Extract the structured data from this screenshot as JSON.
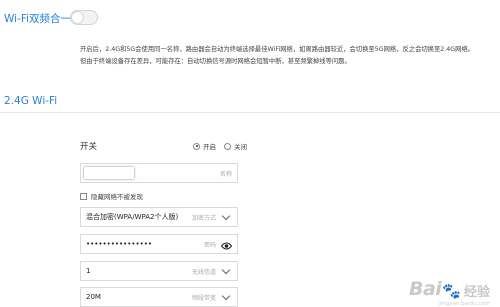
{
  "dual_band": {
    "title": "Wi-Fi双频合一",
    "toggle_on": false
  },
  "description": {
    "line1": "开启后，2.4G和5G会使用同一名称，路由器会自动为终端选择最佳WiFi网络，如离路由器较近，会切换至5G网络，反之会切换至2.4G网络。",
    "line2": "但由于终端设备存在差异，可能存在：自动切换信号源时网络会短暂中断，甚至频繁掉线等问题。"
  },
  "section": {
    "title": "2.4G Wi-Fi"
  },
  "switch": {
    "label": "开关",
    "on_label": "开启",
    "off_label": "关闭",
    "selected": "on"
  },
  "fields": {
    "name": {
      "value": "",
      "tag": "名称"
    },
    "hide_network": {
      "label": "隐藏网络不被发现",
      "checked": false
    },
    "encryption": {
      "value": "混合加密(WPA/WPA2个人版)",
      "tag": "加密方式"
    },
    "password": {
      "value": "••••••••••••••••",
      "tag": "密码"
    },
    "channel": {
      "value": "1",
      "tag": "无线信道"
    },
    "bandwidth": {
      "value": "20M",
      "tag": "频段带宽"
    }
  },
  "icons": {
    "dropdown": "chevron-down-icon",
    "password_visibility": "eye-icon"
  },
  "watermark": {
    "brand": "Bai",
    "suffix": "经验",
    "url": "jingyan.baidu.com"
  },
  "colors": {
    "accent": "#2a7fd8"
  }
}
